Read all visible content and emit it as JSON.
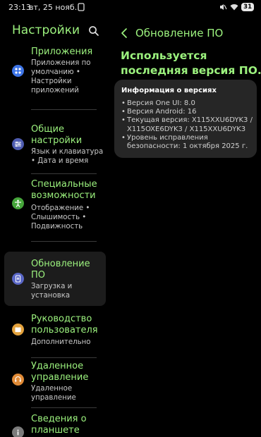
{
  "status_bar": {
    "time": "23:13",
    "date": "вт, 25 нояб.",
    "battery": "31"
  },
  "left": {
    "title": "Настройки",
    "items": [
      {
        "title": "Приложения",
        "subtitle": "Приложения по умолчанию • Настройки приложений",
        "icon": "grid-icon",
        "color": "#3d74e6"
      },
      {
        "title": "Общие настройки",
        "subtitle": "Язык и клавиатура • Дата и время",
        "icon": "sliders-icon",
        "color": "#4e5cb0"
      },
      {
        "title": "Специальные возможности",
        "subtitle": "Отображение • Слышимость • Подвижность",
        "icon": "accessibility-icon",
        "color": "#45a53a"
      },
      {
        "title": "Обновление ПО",
        "subtitle": "Загрузка и установка",
        "icon": "update-icon",
        "color": "#5a67c6"
      },
      {
        "title": "Руководство пользователя",
        "subtitle": "Дополнительно",
        "icon": "user-guide-icon",
        "color": "#e3a23d"
      },
      {
        "title": "Удаленное управление",
        "subtitle": "Удаленное управление",
        "icon": "headset-icon",
        "color": "#e08a36"
      },
      {
        "title": "Сведения о планшете",
        "subtitle": "",
        "icon": "info-icon",
        "color": "#7b7b7b"
      }
    ]
  },
  "right": {
    "header": "Обновление ПО",
    "headline": "Используется последняя версия ПО.",
    "card": {
      "title": "Информация о версиях",
      "lines": [
        "Версия One UI: 8.0",
        "Версия Android: 16",
        "Текущая версия: X115XXU6DYK3 / X115OXE6DYK3 / X115XXU6DYK3",
        "Уровень исправления безопасности: 1 октября 2025 г."
      ]
    }
  }
}
